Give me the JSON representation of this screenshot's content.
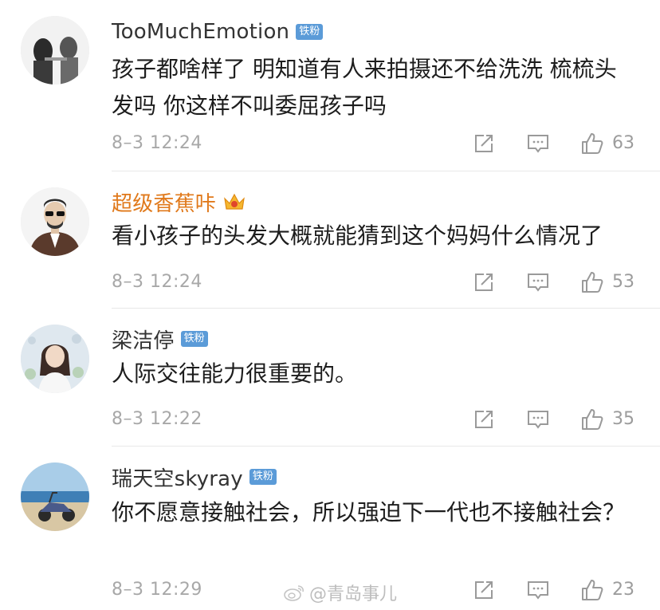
{
  "comments": [
    {
      "username": "TooMuchEmotion",
      "badge": "铁粉",
      "text": "孩子都啥样了 明知道有人来拍摄还不给洗洗 梳梳头发吗 你这样不叫委屈孩子吗",
      "time": "8–3 12:24",
      "likes": "63",
      "avatar_icon": "avatar-couple-photo-icon"
    },
    {
      "username": "超级香蕉咔",
      "badge_icon": "crown-vip-icon",
      "text": "看小孩子的头发大概就能猜到这个妈妈什么情况了",
      "time": "8–3 12:24",
      "likes": "53",
      "avatar_icon": "avatar-cartoon-man-icon"
    },
    {
      "username": "梁洁停",
      "badge": "铁粉",
      "text": "人际交往能力很重要的。",
      "time": "8–3 12:22",
      "likes": "35",
      "avatar_icon": "avatar-girl-photo-icon"
    },
    {
      "username": "瑞天空skyray",
      "badge": "铁粉",
      "text": "你不愿意接触社会，所以强迫下一代也不接触社会？",
      "time": "8–3 12:29",
      "likes": "23",
      "avatar_icon": "avatar-beach-scooter-icon"
    }
  ],
  "watermark": "@青岛事儿",
  "colors": {
    "badge_blue": "#5b9bd8",
    "vip_orange": "#e0791b",
    "meta_gray": "#a8a8a8"
  }
}
